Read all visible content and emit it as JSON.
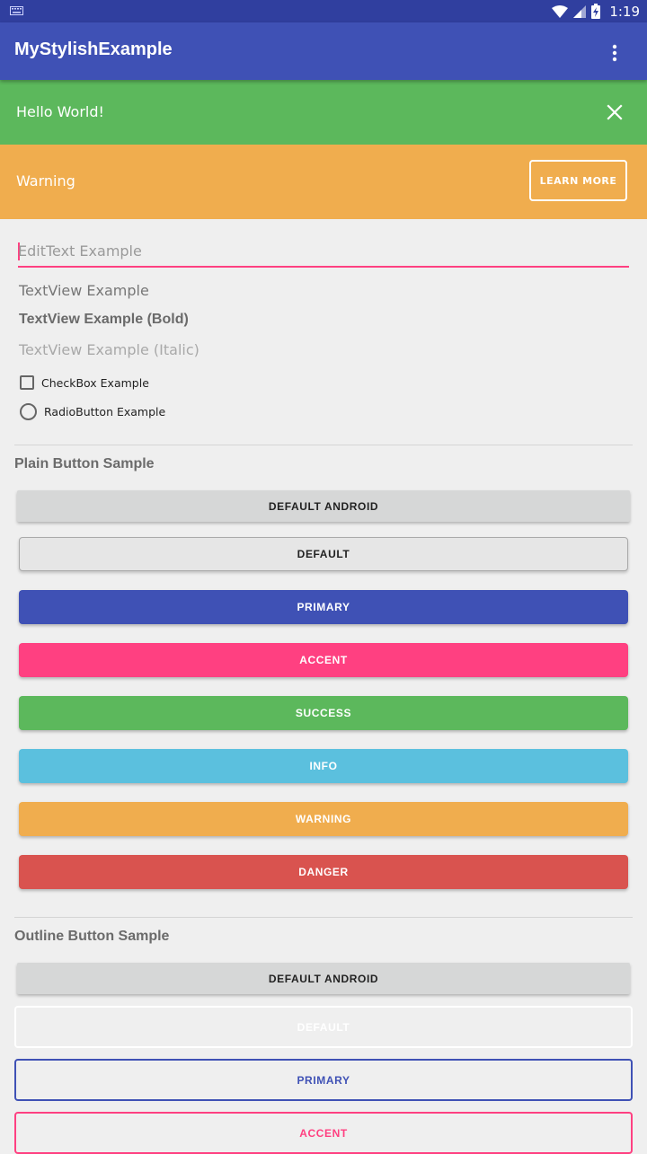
{
  "status_bar": {
    "time": "1:19",
    "icons": [
      "keyboard-icon",
      "wifi-icon",
      "signal-icon",
      "battery-charging-icon"
    ]
  },
  "app_bar": {
    "title": "MyStylishExample",
    "menu_icon": "more-vert-icon"
  },
  "alerts": {
    "success": {
      "message": "Hello World!",
      "close_icon": "close-icon",
      "color": "#5cb85c"
    },
    "warning": {
      "message": "Warning",
      "button_label": "LEARN MORE",
      "color": "#f0ad4e"
    }
  },
  "form": {
    "edit_placeholder": "EditText Example",
    "textview": "TextView Example",
    "textview_bold": "TextView Example (Bold)",
    "textview_italic": "TextView Example (Italic)",
    "checkbox_label": "CheckBox Example",
    "radio_label": "RadioButton Example"
  },
  "plain_section": {
    "title": "Plain Button Sample",
    "buttons": {
      "default_android": "DEFAULT ANDROID",
      "default": "DEFAULT",
      "primary": "PRIMARY",
      "accent": "ACCENT",
      "success": "SUCCESS",
      "info": "INFO",
      "warning": "WARNING",
      "danger": "DANGER"
    }
  },
  "outline_section": {
    "title": "Outline Button Sample",
    "buttons": {
      "default_android": "DEFAULT ANDROID",
      "default": "DEFAULT",
      "primary": "PRIMARY",
      "accent": "ACCENT"
    }
  },
  "colors": {
    "primary": "#3f51b5",
    "primary_dark": "#303f9f",
    "accent": "#ff4081",
    "success": "#5cb85c",
    "info": "#5bc0de",
    "warning": "#f0ad4e",
    "danger": "#d9534f"
  }
}
